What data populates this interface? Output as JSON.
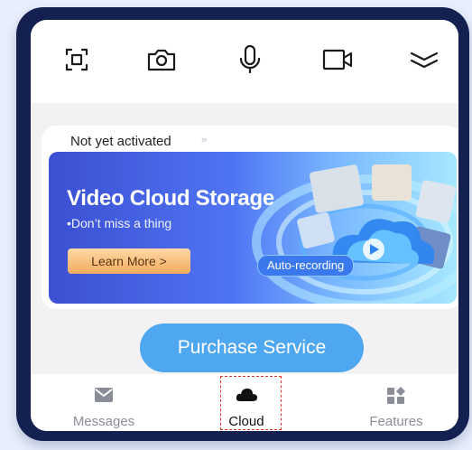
{
  "toolbar": {
    "tools": [
      "scan-icon",
      "camera-icon",
      "microphone-icon",
      "video-camera-icon",
      "collapse-icon"
    ]
  },
  "service": {
    "status": "Not yet activated",
    "status_chevron": "››"
  },
  "banner": {
    "title": "Video Cloud Storage",
    "subtitle": "•Don’t miss a thing",
    "button_label": "Learn More >",
    "badge": "Auto-recording"
  },
  "purchase": {
    "label": "Purchase Service"
  },
  "tabs": [
    {
      "label": "Messages",
      "icon": "envelope-icon",
      "active": false
    },
    {
      "label": "Cloud",
      "icon": "cloud-icon",
      "active": true
    },
    {
      "label": "Features",
      "icon": "features-grid-icon",
      "active": false
    }
  ],
  "colors": {
    "accent": "#4fa7f2",
    "frame": "#142050",
    "highlight": "#d9342b"
  }
}
